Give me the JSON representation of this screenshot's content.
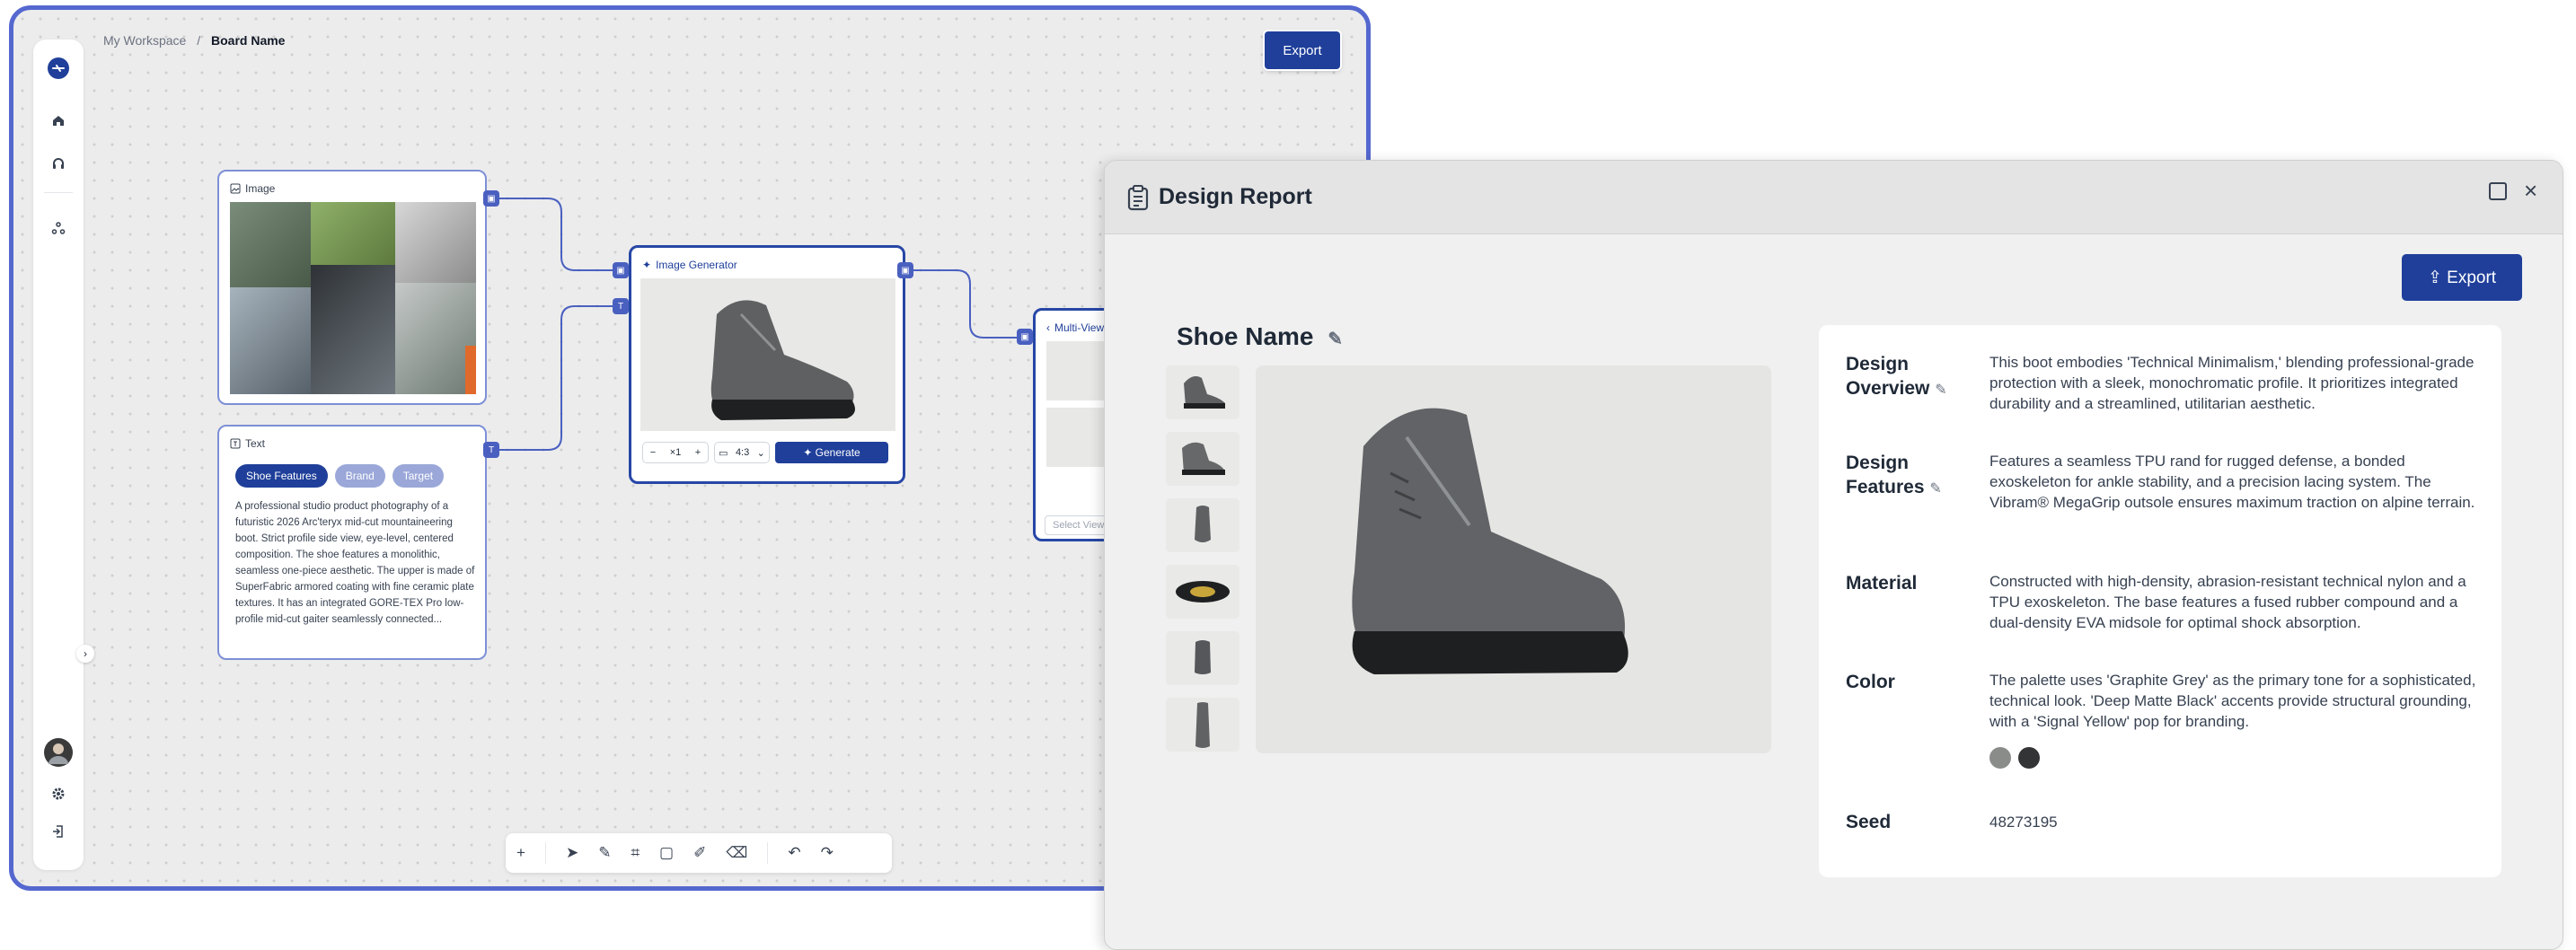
{
  "breadcrumb": {
    "workspace": "My Workspace",
    "separator": "/",
    "board": "Board Name"
  },
  "toolbar": {
    "export_label": "Export"
  },
  "nodes": {
    "image": {
      "title": "Image"
    },
    "text": {
      "title": "Text",
      "chips": [
        "Shoe Features",
        "Brand",
        "Target"
      ],
      "body": "A professional studio product photography of a futuristic 2026 Arc'teryx mid-cut mountaineering boot. Strict profile side view, eye-level, centered composition. The shoe features a monolithic, seamless one-piece aesthetic. The upper is made of SuperFabric armored coating with fine ceramic plate textures. It has an integrated GORE-TEX Pro low-profile mid-cut gaiter seamlessly connected..."
    },
    "generator": {
      "title": "Image Generator",
      "count": "×1",
      "ratio": "4:3",
      "generate_label": "Generate"
    },
    "multiview": {
      "title": "Multi-View",
      "select_placeholder": "Select View"
    }
  },
  "report": {
    "title": "Design Report",
    "export_label": "Export",
    "shoe_name": "Shoe Name",
    "fields": [
      {
        "label": "Design Overview",
        "value": "This boot embodies 'Technical Minimalism,' blending professional-grade protection with a sleek, monochromatic profile. It prioritizes integrated durability and a streamlined, utilitarian aesthetic."
      },
      {
        "label": "Design Features",
        "value": "Features a seamless TPU rand for rugged defense, a bonded exoskeleton for ankle stability, and a precision lacing system. The Vibram® MegaGrip outsole ensures maximum traction on alpine terrain."
      },
      {
        "label": "Material",
        "value": "Constructed with high-density, abrasion-resistant technical nylon and a TPU exoskeleton. The base features a fused rubber compound and a dual-density EVA midsole for optimal shock absorption."
      },
      {
        "label": "Color",
        "value": "The palette uses 'Graphite Grey' as the primary tone for a sophisticated, technical look. 'Deep Matte Black' accents provide structural grounding, with a 'Signal Yellow' pop for branding."
      },
      {
        "label": "Seed",
        "value": "48273195"
      }
    ],
    "swatches": [
      "#8a8c8a",
      "#333435"
    ]
  },
  "colors": {
    "accent": "#1f3f9a",
    "frame": "#5468cf"
  }
}
